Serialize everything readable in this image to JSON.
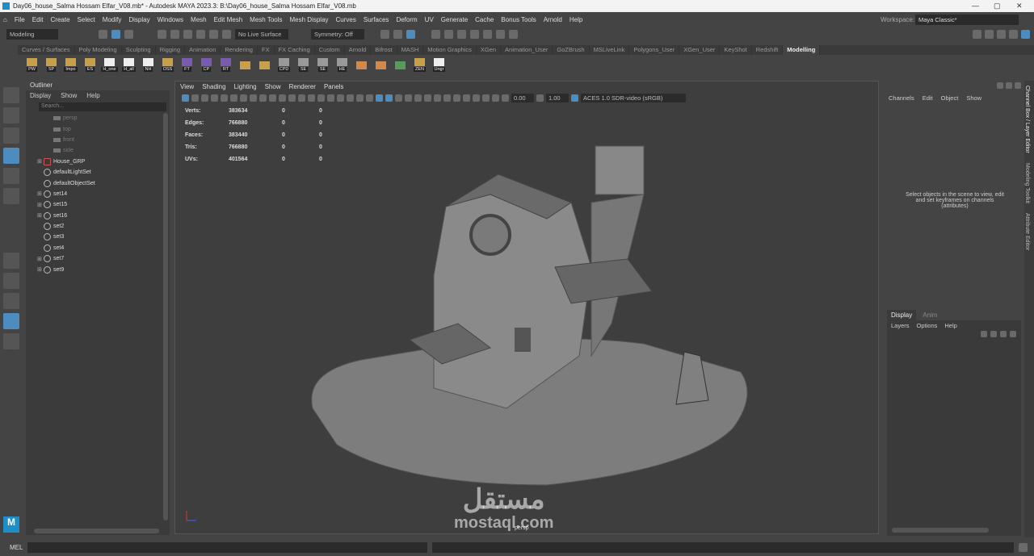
{
  "title": "Day06_house_Salma Hossam Elfar_V08.mb* - Autodesk MAYA 2023.3: B:\\Day06_house_Salma Hossam Elfar_V08.mb",
  "menus": [
    "File",
    "Edit",
    "Create",
    "Select",
    "Modify",
    "Display",
    "Windows",
    "Mesh",
    "Edit Mesh",
    "Mesh Tools",
    "Mesh Display",
    "Curves",
    "Surfaces",
    "Deform",
    "UV",
    "Generate",
    "Cache",
    "Bonus Tools",
    "Arnold",
    "Help"
  ],
  "workspace": {
    "label": "Workspace:",
    "value": "Maya Classic*"
  },
  "status": {
    "mode": "Modeling",
    "live_surface": "No Live Surface",
    "symmetry": "Symmetry: Off"
  },
  "shelf_tabs": [
    "Curves / Surfaces",
    "Poly Modeling",
    "Sculpting",
    "Rigging",
    "Animation",
    "Rendering",
    "FX",
    "FX Caching",
    "Custom",
    "Arnold",
    "Bifrost",
    "MASH",
    "Motion Graphics",
    "XGen",
    "Animation_User",
    "GoZBrush",
    "MSLiveLink",
    "Polygons_User",
    "XGen_User",
    "KeyShot",
    "Redshift",
    "Modelling"
  ],
  "active_shelf": "Modelling",
  "shelf_buttons": [
    "PW",
    "SP",
    "Impo",
    "ES",
    "H_one",
    "H_all",
    "NH",
    "OSS",
    "FT",
    "CP",
    "RT",
    "",
    "",
    "CPD",
    "SE",
    "SE",
    "HE",
    "",
    "",
    "",
    "ZEN",
    "Ungr"
  ],
  "outliner": {
    "title": "Outliner",
    "menu": [
      "Display",
      "Show",
      "Help"
    ],
    "search_placeholder": "Search...",
    "items": [
      {
        "name": "persp",
        "type": "camera"
      },
      {
        "name": "top",
        "type": "camera"
      },
      {
        "name": "front",
        "type": "camera"
      },
      {
        "name": "side",
        "type": "camera"
      },
      {
        "name": "House_GRP",
        "type": "group",
        "expandable": true
      },
      {
        "name": "defaultLightSet",
        "type": "set"
      },
      {
        "name": "defaultObjectSet",
        "type": "set"
      },
      {
        "name": "set14",
        "type": "set",
        "expandable": true
      },
      {
        "name": "set15",
        "type": "set",
        "expandable": true
      },
      {
        "name": "set16",
        "type": "set",
        "expandable": true
      },
      {
        "name": "set2",
        "type": "set"
      },
      {
        "name": "set3",
        "type": "set"
      },
      {
        "name": "set4",
        "type": "set"
      },
      {
        "name": "set7",
        "type": "set",
        "expandable": true
      },
      {
        "name": "set9",
        "type": "set",
        "expandable": true
      }
    ]
  },
  "viewport": {
    "menu": [
      "View",
      "Shading",
      "Lighting",
      "Show",
      "Renderer",
      "Panels"
    ],
    "exposure": "0.00",
    "gamma": "1.00",
    "color_space": "ACES 1.0 SDR-video (sRGB)",
    "camera": "persp",
    "hud": [
      {
        "label": "Verts:",
        "values": [
          "383634",
          "0",
          "0"
        ]
      },
      {
        "label": "Edges:",
        "values": [
          "766880",
          "0",
          "0"
        ]
      },
      {
        "label": "Faces:",
        "values": [
          "383440",
          "0",
          "0"
        ]
      },
      {
        "label": "Tris:",
        "values": [
          "766880",
          "0",
          "0"
        ]
      },
      {
        "label": "UVs:",
        "values": [
          "401564",
          "0",
          "0"
        ]
      }
    ]
  },
  "channel_box": {
    "menu": [
      "Channels",
      "Edit",
      "Object",
      "Show"
    ],
    "message": "Select objects in the scene to view, edit and set keyframes on channels (attributes)"
  },
  "layer_editor": {
    "tabs": [
      "Display",
      "Anim"
    ],
    "menu": [
      "Layers",
      "Options",
      "Help"
    ]
  },
  "side_tabs": [
    "Channel Box / Layer Editor",
    "Modeling Toolkit",
    "Attribute Editor"
  ],
  "command_line": {
    "label": "MEL"
  },
  "watermark": {
    "arabic": "مستقل",
    "latin": "mostaql.com"
  }
}
